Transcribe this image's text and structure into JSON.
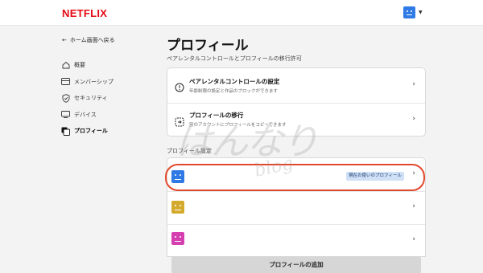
{
  "header": {
    "logo": "NETFLIX",
    "avatar_icon": "smile-profile-icon",
    "caret_icon": "caret-down-icon"
  },
  "sidebar": {
    "back_label": "ホーム画面へ戻る",
    "items": [
      {
        "label": "概要",
        "icon": "home-icon"
      },
      {
        "label": "メンバーシップ",
        "icon": "card-icon"
      },
      {
        "label": "セキュリティ",
        "icon": "shield-icon"
      },
      {
        "label": "デバイス",
        "icon": "device-icon"
      },
      {
        "label": "プロフィール",
        "icon": "profiles-icon",
        "active": true
      }
    ]
  },
  "main": {
    "title": "プロフィール",
    "subtitle": "ペアレンタルコントロールとプロフィールの移行許可",
    "settings": [
      {
        "title": "ペアレンタルコントロールの設定",
        "desc": "年齢制限の設定と作品のブロックができます",
        "icon": "alert-circle-icon"
      },
      {
        "title": "プロフィールの移行",
        "desc": "別のアカウントにプロフィールをコピーできます",
        "icon": "transfer-icon"
      }
    ],
    "section_label": "プロフィール設定",
    "profiles": [
      {
        "color": "#2f7ae5",
        "badge": "現在お使いのプロフィール"
      },
      {
        "color": "#d4aa2e",
        "badge": ""
      },
      {
        "color": "#d63fb0",
        "badge": ""
      }
    ],
    "add_button": "プロフィールの追加"
  },
  "watermark": {
    "main": "はんなり",
    "sub": "blog"
  },
  "colors": {
    "accent_red": "#e50914",
    "highlight": "#e2482c"
  }
}
